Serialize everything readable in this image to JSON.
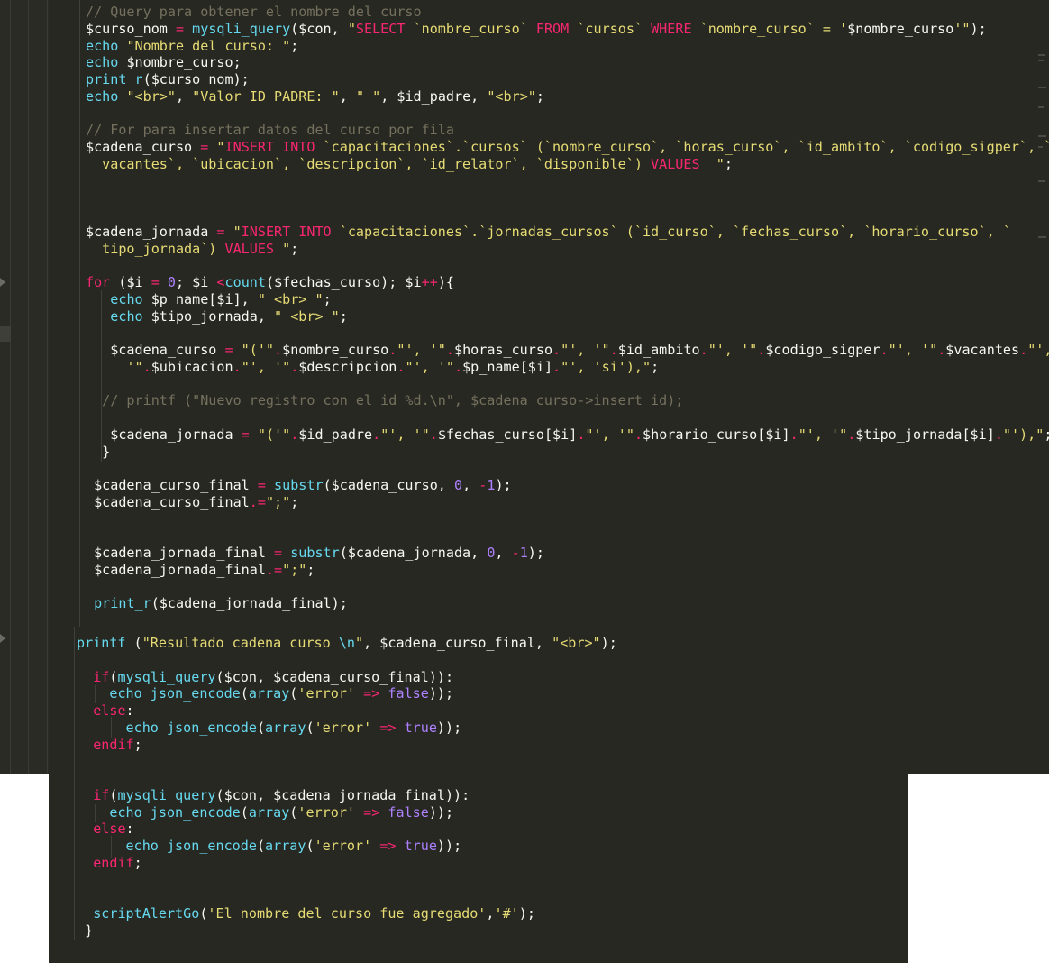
{
  "editor": {
    "language": "php",
    "theme_colors": {
      "background": "#272822",
      "comment": "#75715e",
      "string": "#e6db74",
      "keyword": "#f92672",
      "function": "#66d9ef",
      "number": "#ae81ff",
      "default": "#f8f8f2"
    },
    "code_lines": [
      [
        [
          "c",
          "// Query para obtener el nombre del curso"
        ]
      ],
      [
        [
          "v",
          "$curso_nom "
        ],
        [
          "k",
          "="
        ],
        [
          "v",
          " "
        ],
        [
          "f",
          "mysqli_query"
        ],
        [
          "v",
          "($con, "
        ],
        [
          "s",
          "\""
        ],
        [
          "k",
          "SELECT"
        ],
        [
          "s",
          " `nombre_curso` "
        ],
        [
          "k",
          "FROM"
        ],
        [
          "s",
          " `cursos` "
        ],
        [
          "k",
          "WHERE"
        ],
        [
          "s",
          " `nombre_curso` = '"
        ],
        [
          "v",
          "$nombre_curso"
        ],
        [
          "s",
          "'\""
        ],
        [
          "v",
          ");"
        ]
      ],
      [
        [
          "f",
          "echo"
        ],
        [
          "v",
          " "
        ],
        [
          "s",
          "\"Nombre del curso: \""
        ],
        [
          "v",
          ";"
        ]
      ],
      [
        [
          "f",
          "echo"
        ],
        [
          "v",
          " $nombre_curso;"
        ]
      ],
      [
        [
          "f",
          "print_r"
        ],
        [
          "v",
          "($curso_nom);"
        ]
      ],
      [
        [
          "f",
          "echo"
        ],
        [
          "v",
          " "
        ],
        [
          "s",
          "\"<br>\""
        ],
        [
          "v",
          ", "
        ],
        [
          "s",
          "\"Valor ID PADRE: \""
        ],
        [
          "v",
          ", "
        ],
        [
          "s",
          "\" \""
        ],
        [
          "v",
          ", $id_padre, "
        ],
        [
          "s",
          "\"<br>\""
        ],
        [
          "v",
          ";"
        ]
      ],
      [],
      [
        [
          "c",
          "// For para insertar datos del curso por fila"
        ]
      ],
      [
        [
          "v",
          "$cadena_curso "
        ],
        [
          "k",
          "="
        ],
        [
          "v",
          " "
        ],
        [
          "s",
          "\""
        ],
        [
          "k",
          "INSERT INTO"
        ],
        [
          "s",
          " `capacitaciones`.`cursos` (`nombre_curso`, `horas_curso`, `id_ambito`, `codigo_sigper`, `"
        ]
      ],
      [
        [
          "s",
          "  vacantes`, `ubicacion`, `descripcion`, `id_relator`, `disponible`) "
        ],
        [
          "k",
          "VALUES"
        ],
        [
          "s",
          "  \""
        ],
        [
          "v",
          ";"
        ]
      ],
      [],
      [],
      [],
      [
        [
          "v",
          "$cadena_jornada "
        ],
        [
          "k",
          "="
        ],
        [
          "v",
          " "
        ],
        [
          "s",
          "\""
        ],
        [
          "k",
          "INSERT INTO"
        ],
        [
          "s",
          " `capacitaciones`.`jornadas_cursos` (`id_curso`, `fechas_curso`, `horario_curso`, `"
        ]
      ],
      [
        [
          "s",
          "  tipo_jornada`) "
        ],
        [
          "k",
          "VALUES"
        ],
        [
          "s",
          " \""
        ],
        [
          "v",
          ";"
        ]
      ],
      [],
      [
        [
          "k",
          "for"
        ],
        [
          "v",
          " ($i "
        ],
        [
          "k",
          "="
        ],
        [
          "v",
          " "
        ],
        [
          "n",
          "0"
        ],
        [
          "v",
          "; $i "
        ],
        [
          "k",
          "<"
        ],
        [
          "f",
          "count"
        ],
        [
          "v",
          "($fechas_curso); $i"
        ],
        [
          "k",
          "++"
        ],
        [
          "v",
          "){"
        ]
      ],
      [
        [
          "v",
          "   "
        ],
        [
          "f",
          "echo"
        ],
        [
          "v",
          " $p_name[$i], "
        ],
        [
          "s",
          "\" <br> \""
        ],
        [
          "v",
          ";"
        ]
      ],
      [
        [
          "v",
          "   "
        ],
        [
          "f",
          "echo"
        ],
        [
          "v",
          " $tipo_jornada, "
        ],
        [
          "s",
          "\" <br> \""
        ],
        [
          "v",
          ";"
        ]
      ],
      [],
      [
        [
          "v",
          "   $cadena_curso "
        ],
        [
          "k",
          "="
        ],
        [
          "v",
          " "
        ],
        [
          "s",
          "\"('\""
        ],
        [
          "k",
          "."
        ],
        [
          "v",
          "$nombre_curso"
        ],
        [
          "k",
          "."
        ],
        [
          "s",
          "\"', '\""
        ],
        [
          "k",
          "."
        ],
        [
          "v",
          "$horas_curso"
        ],
        [
          "k",
          "."
        ],
        [
          "s",
          "\"', '\""
        ],
        [
          "k",
          "."
        ],
        [
          "v",
          "$id_ambito"
        ],
        [
          "k",
          "."
        ],
        [
          "s",
          "\"', '\""
        ],
        [
          "k",
          "."
        ],
        [
          "v",
          "$codigo_sigper"
        ],
        [
          "k",
          "."
        ],
        [
          "s",
          "\"', '\""
        ],
        [
          "k",
          "."
        ],
        [
          "v",
          "$vacantes"
        ],
        [
          "k",
          "."
        ],
        [
          "s",
          "\"',"
        ]
      ],
      [
        [
          "s",
          "     '\""
        ],
        [
          "k",
          "."
        ],
        [
          "v",
          "$ubicacion"
        ],
        [
          "k",
          "."
        ],
        [
          "s",
          "\"', '\""
        ],
        [
          "k",
          "."
        ],
        [
          "v",
          "$descripcion"
        ],
        [
          "k",
          "."
        ],
        [
          "s",
          "\"', '\""
        ],
        [
          "k",
          "."
        ],
        [
          "v",
          "$p_name[$i]"
        ],
        [
          "k",
          "."
        ],
        [
          "s",
          "\"', 'si'),\""
        ],
        [
          "v",
          ";"
        ]
      ],
      [],
      [
        [
          "c",
          "  // printf (\"Nuevo registro con el id %d.\\n\", $cadena_curso->insert_id);"
        ]
      ],
      [],
      [
        [
          "v",
          "   $cadena_jornada "
        ],
        [
          "k",
          "="
        ],
        [
          "v",
          " "
        ],
        [
          "s",
          "\"('\""
        ],
        [
          "k",
          "."
        ],
        [
          "v",
          "$id_padre"
        ],
        [
          "k",
          "."
        ],
        [
          "s",
          "\"', '\""
        ],
        [
          "k",
          "."
        ],
        [
          "v",
          "$fechas_curso[$i]"
        ],
        [
          "k",
          "."
        ],
        [
          "s",
          "\"', '\""
        ],
        [
          "k",
          "."
        ],
        [
          "v",
          "$horario_curso[$i]"
        ],
        [
          "k",
          "."
        ],
        [
          "s",
          "\"', '\""
        ],
        [
          "k",
          "."
        ],
        [
          "v",
          "$tipo_jornada[$i]"
        ],
        [
          "k",
          "."
        ],
        [
          "s",
          "\"'),\""
        ],
        [
          "v",
          ";"
        ]
      ],
      [
        [
          "v",
          "  }"
        ]
      ],
      [],
      [
        [
          "v",
          " $cadena_curso_final "
        ],
        [
          "k",
          "="
        ],
        [
          "v",
          " "
        ],
        [
          "f",
          "substr"
        ],
        [
          "v",
          "($cadena_curso, "
        ],
        [
          "n",
          "0"
        ],
        [
          "v",
          ", "
        ],
        [
          "k",
          "-"
        ],
        [
          "n",
          "1"
        ],
        [
          "v",
          ");"
        ]
      ],
      [
        [
          "v",
          " $cadena_curso_final"
        ],
        [
          "k",
          ".="
        ],
        [
          "s",
          "\";\""
        ],
        [
          "v",
          ";"
        ]
      ],
      [],
      [],
      [
        [
          "v",
          " $cadena_jornada_final "
        ],
        [
          "k",
          "="
        ],
        [
          "v",
          " "
        ],
        [
          "f",
          "substr"
        ],
        [
          "v",
          "($cadena_jornada, "
        ],
        [
          "n",
          "0"
        ],
        [
          "v",
          ", "
        ],
        [
          "k",
          "-"
        ],
        [
          "n",
          "1"
        ],
        [
          "v",
          ");"
        ]
      ],
      [
        [
          "v",
          " $cadena_jornada_final"
        ],
        [
          "k",
          ".="
        ],
        [
          "s",
          "\";\""
        ],
        [
          "v",
          ";"
        ]
      ],
      [],
      [
        [
          "v",
          " "
        ],
        [
          "f",
          "print_r"
        ],
        [
          "v",
          "($cadena_jornada_final);"
        ]
      ]
    ],
    "code_lines_lower": [
      [
        [
          "f",
          "printf"
        ],
        [
          "v",
          " ("
        ],
        [
          "s",
          "\"Resultado cadena curso "
        ],
        [
          "f",
          "\\n"
        ],
        [
          "s",
          "\""
        ],
        [
          "v",
          ", $cadena_curso_final, "
        ],
        [
          "s",
          "\"<br>\""
        ],
        [
          "v",
          ");"
        ]
      ],
      [],
      [
        [
          "v",
          "  "
        ],
        [
          "k",
          "if"
        ],
        [
          "v",
          "("
        ],
        [
          "f",
          "mysqli_query"
        ],
        [
          "v",
          "($con, $cadena_curso_final)):"
        ]
      ],
      [
        [
          "v",
          "    "
        ],
        [
          "f",
          "echo json_encode"
        ],
        [
          "v",
          "("
        ],
        [
          "f",
          "array"
        ],
        [
          "v",
          "("
        ],
        [
          "s",
          "'error'"
        ],
        [
          "v",
          " "
        ],
        [
          "k",
          "=>"
        ],
        [
          "v",
          " "
        ],
        [
          "n",
          "false"
        ],
        [
          "v",
          "));"
        ]
      ],
      [
        [
          "v",
          "  "
        ],
        [
          "k",
          "else"
        ],
        [
          "v",
          ":"
        ]
      ],
      [
        [
          "v",
          "      "
        ],
        [
          "f",
          "echo json_encode"
        ],
        [
          "v",
          "("
        ],
        [
          "f",
          "array"
        ],
        [
          "v",
          "("
        ],
        [
          "s",
          "'error'"
        ],
        [
          "v",
          " "
        ],
        [
          "k",
          "=>"
        ],
        [
          "v",
          " "
        ],
        [
          "n",
          "true"
        ],
        [
          "v",
          "));"
        ]
      ],
      [
        [
          "v",
          "  "
        ],
        [
          "k",
          "endif"
        ],
        [
          "v",
          ";"
        ]
      ],
      [],
      [],
      [
        [
          "v",
          "  "
        ],
        [
          "k",
          "if"
        ],
        [
          "v",
          "("
        ],
        [
          "f",
          "mysqli_query"
        ],
        [
          "v",
          "($con, $cadena_jornada_final)):"
        ]
      ],
      [
        [
          "v",
          "    "
        ],
        [
          "f",
          "echo json_encode"
        ],
        [
          "v",
          "("
        ],
        [
          "f",
          "array"
        ],
        [
          "v",
          "("
        ],
        [
          "s",
          "'error'"
        ],
        [
          "v",
          " "
        ],
        [
          "k",
          "=>"
        ],
        [
          "v",
          " "
        ],
        [
          "n",
          "false"
        ],
        [
          "v",
          "));"
        ]
      ],
      [
        [
          "v",
          "  "
        ],
        [
          "k",
          "else"
        ],
        [
          "v",
          ":"
        ]
      ],
      [
        [
          "v",
          "      "
        ],
        [
          "f",
          "echo json_encode"
        ],
        [
          "v",
          "("
        ],
        [
          "f",
          "array"
        ],
        [
          "v",
          "("
        ],
        [
          "s",
          "'error'"
        ],
        [
          "v",
          " "
        ],
        [
          "k",
          "=>"
        ],
        [
          "v",
          " "
        ],
        [
          "n",
          "true"
        ],
        [
          "v",
          "));"
        ]
      ],
      [
        [
          "v",
          "  "
        ],
        [
          "k",
          "endif"
        ],
        [
          "v",
          ";"
        ]
      ],
      [],
      [],
      [
        [
          "v",
          "  "
        ],
        [
          "f",
          "scriptAlertGo"
        ],
        [
          "v",
          "("
        ],
        [
          "s",
          "'El nombre del curso fue agregado'"
        ],
        [
          "v",
          ","
        ],
        [
          "s",
          "'#'"
        ],
        [
          "v",
          ");"
        ]
      ],
      [
        [
          "v",
          " }"
        ]
      ]
    ]
  }
}
